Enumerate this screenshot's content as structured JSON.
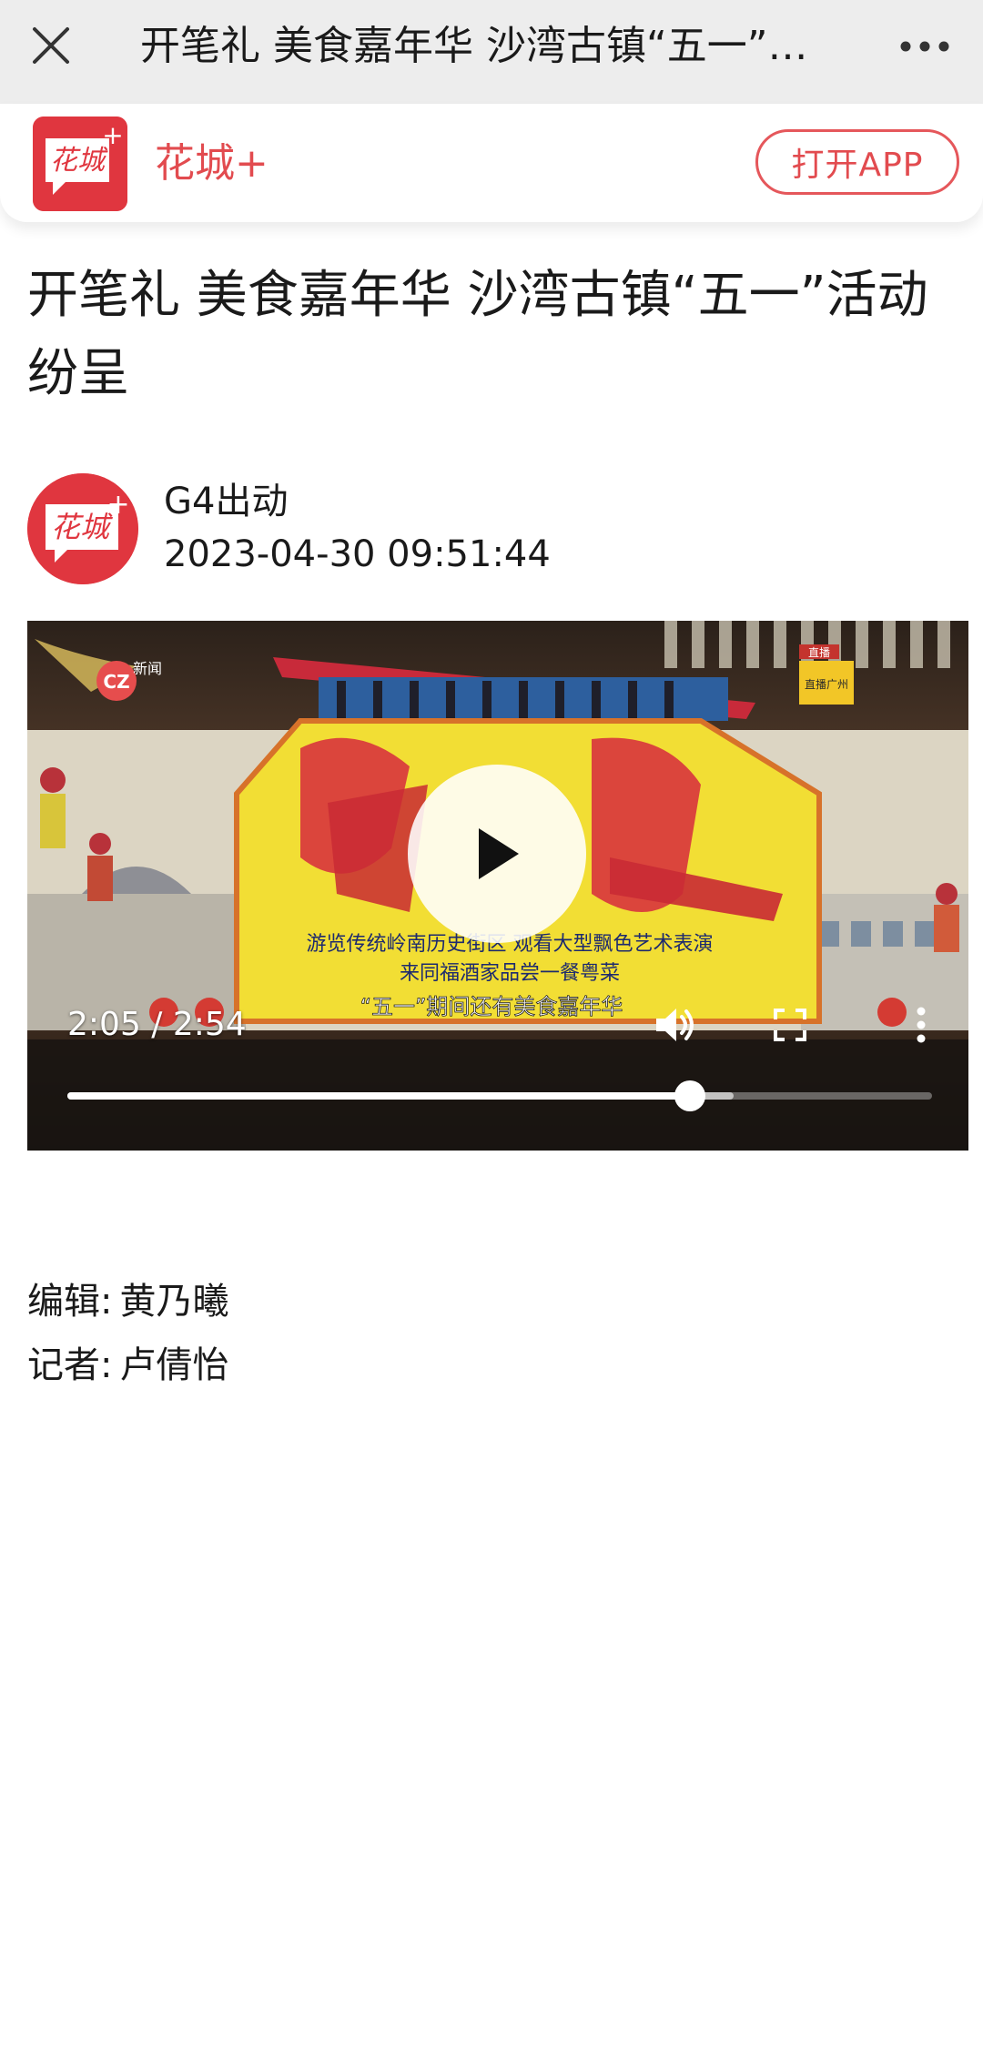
{
  "top_bar": {
    "title": "开笔礼 美食嘉年华 沙湾古镇“五一”…",
    "close_icon": "close-icon",
    "more_icon": "more-horizontal-icon"
  },
  "app_banner": {
    "logo_text": "花城+",
    "app_name": "花城+",
    "open_app_label": "打开APP"
  },
  "article": {
    "title": "开笔礼 美食嘉年华 沙湾古镇“五一”活动纷呈",
    "author": {
      "name": "G4出动",
      "time": "2023-04-30 09:51:44"
    }
  },
  "video": {
    "time_display": "2:05 / 2:54",
    "progress_fraction": 0.72,
    "buffered_fraction": 0.77,
    "frame_texts": {
      "channel_logo": "新闻",
      "live_badge_top": "直播",
      "live_badge_main": "直播广州",
      "line1": "游览传统岭南历史街区    观看大型飘色艺术表演",
      "line2": "来同福酒家品尝一餐粤菜",
      "line3": "“五一”期间还有美食嘉年华"
    }
  },
  "credits": {
    "editor_label": "编辑:",
    "editor_name": "黄乃曦",
    "reporter_label": "记者:",
    "reporter_name": "卢倩怡"
  },
  "colors": {
    "brand_red": "#e0363f",
    "link_red": "#e24b4f",
    "top_bar_bg": "#ededed"
  }
}
